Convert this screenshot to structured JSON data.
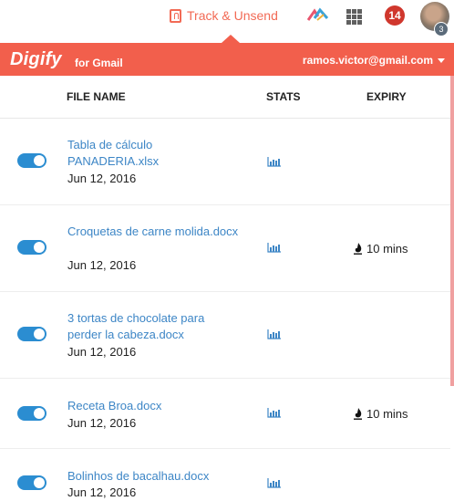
{
  "topbar": {
    "track_label": "Track & Unsend",
    "notification_count": "14",
    "avatar_sub": "3"
  },
  "header": {
    "logo": "Digify",
    "logo_sub": "for Gmail",
    "account": "ramos.victor@gmail.com"
  },
  "columns": {
    "file_name": "FILE NAME",
    "stats": "STATS",
    "expiry": "EXPIRY"
  },
  "files": [
    {
      "name": "Tabla de cálculo PANADERIA.xlsx",
      "date": "Jun 12, 2016",
      "expiry": "",
      "enabled": true
    },
    {
      "name": "Croquetas de carne molida.docx",
      "date": "Jun 12, 2016",
      "expiry": "10 mins",
      "enabled": true
    },
    {
      "name": "3 tortas de chocolate para perder la cabeza.docx",
      "date": "Jun 12, 2016",
      "expiry": "",
      "enabled": true
    },
    {
      "name": "Receta Broa.docx",
      "date": "Jun 12, 2016",
      "expiry": "10 mins",
      "enabled": true
    },
    {
      "name": "Bolinhos de bacalhau.docx",
      "date": "Jun 12, 2016",
      "expiry": "",
      "enabled": true
    }
  ],
  "colors": {
    "accent": "#f25f4c",
    "link": "#3d86c6",
    "toggle": "#2b8dd1"
  }
}
